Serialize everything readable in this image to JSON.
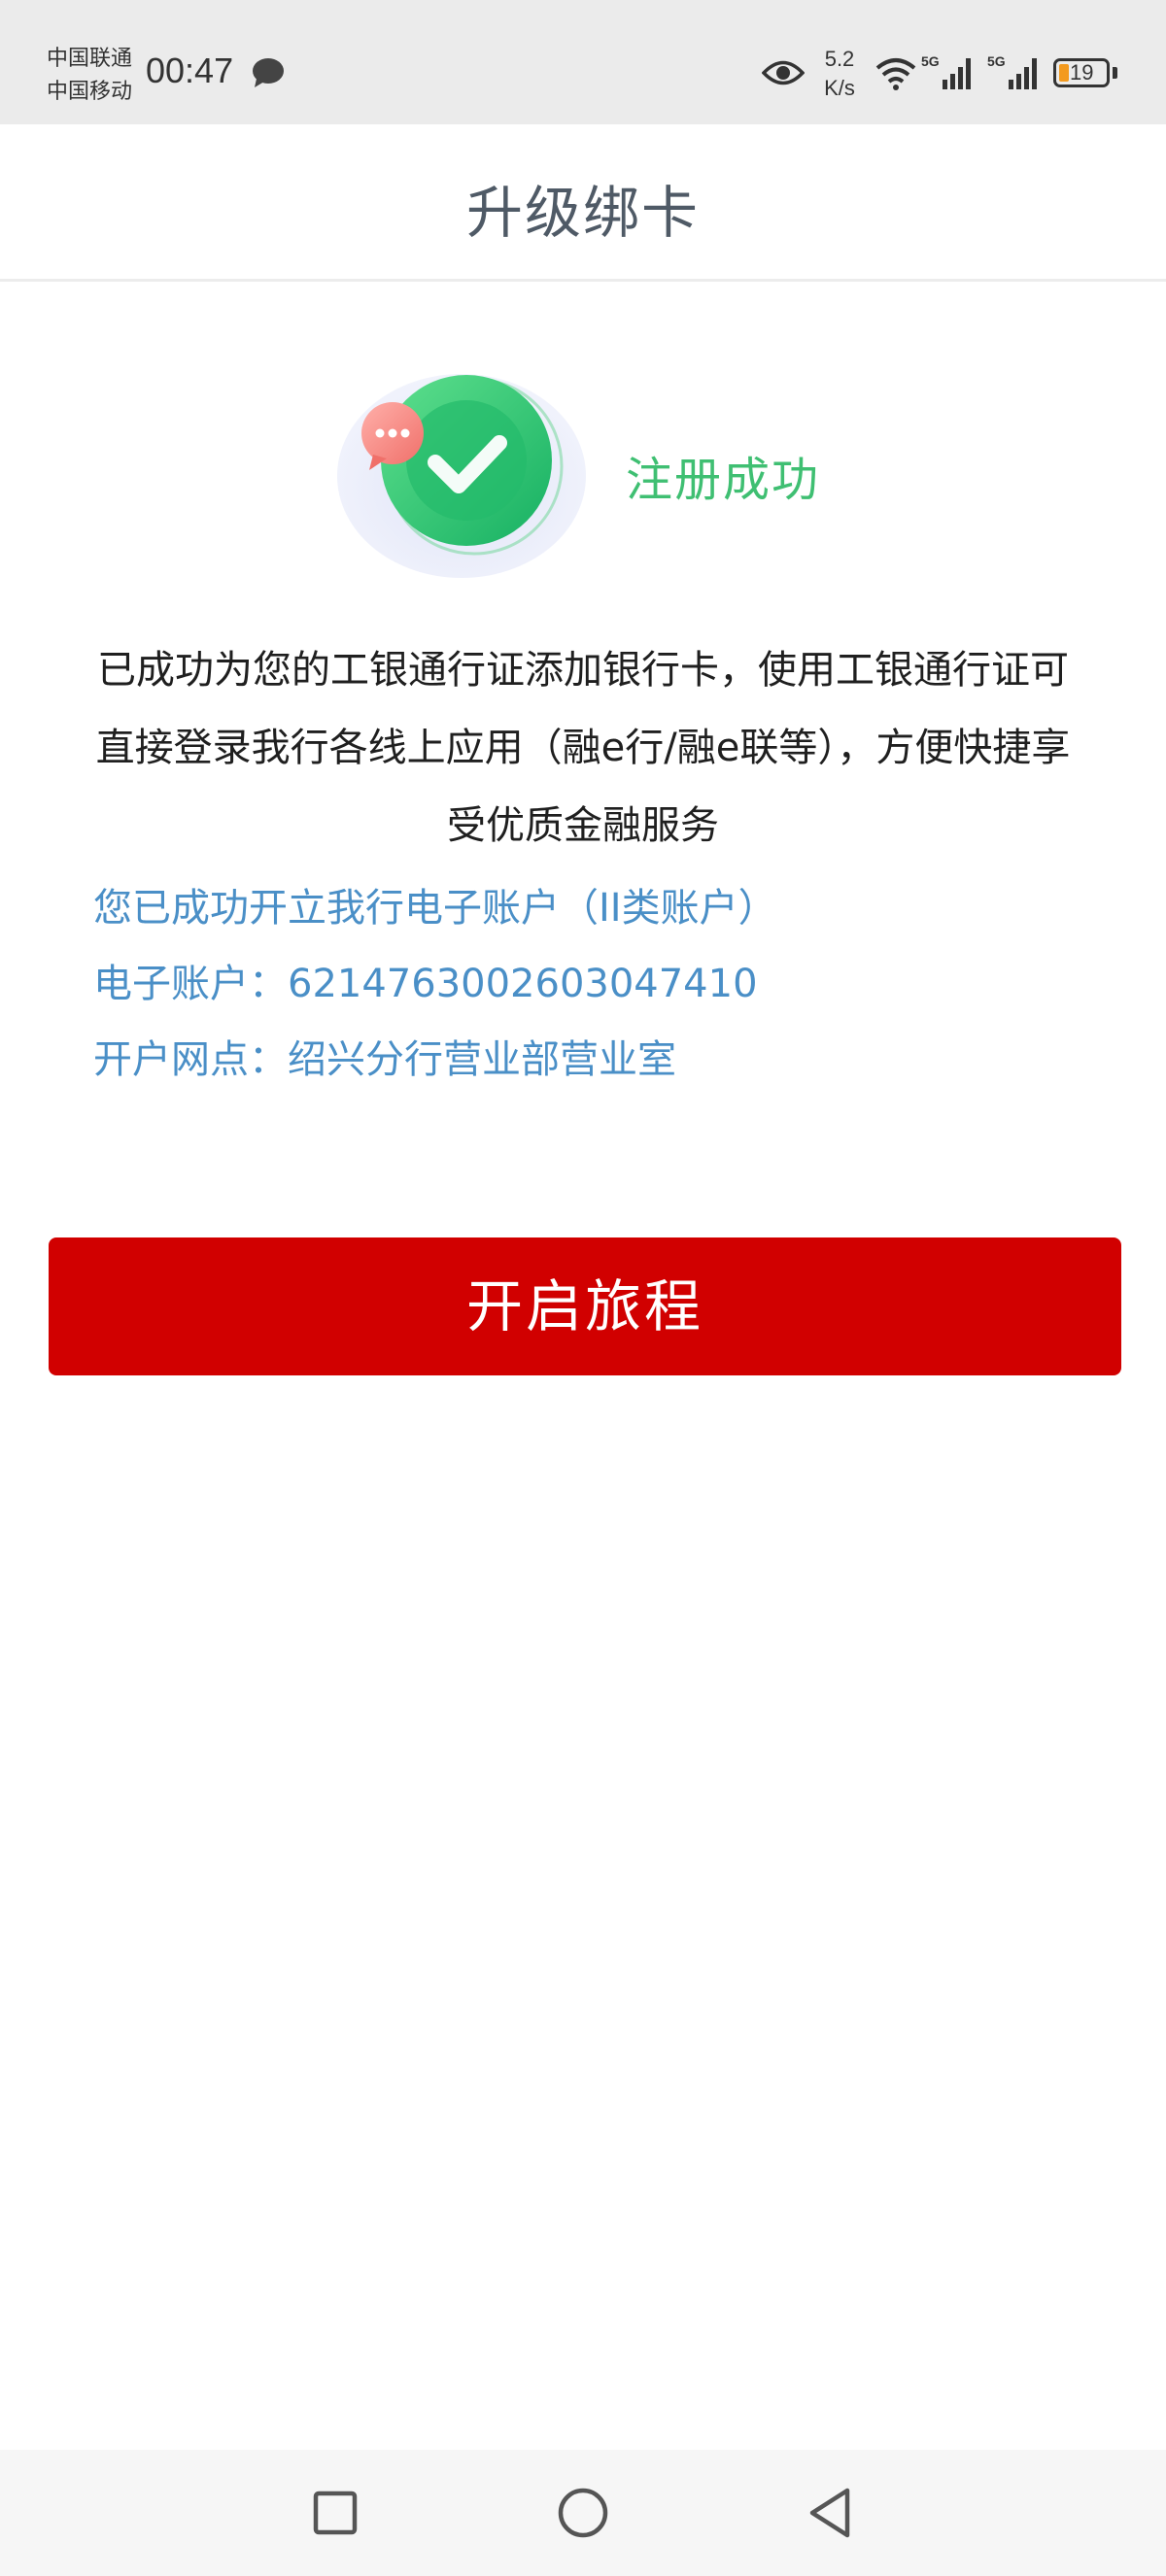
{
  "status_bar": {
    "carrier_1": "中国联通",
    "carrier_2": "中国移动",
    "time": "00:47",
    "net_speed_value": "5.2",
    "net_speed_unit": "K/s",
    "signal_1_label": "5G",
    "signal_2_label": "5G",
    "battery_level": "19",
    "battery_color": "#f39a1e"
  },
  "header": {
    "title": "升级绑卡"
  },
  "success": {
    "status_text": "注册成功",
    "accent_color": "#3fbf72",
    "icon": "check-circle-icon",
    "badge_icon": "chat-bubble-icon"
  },
  "main": {
    "description": "已成功为您的工银通行证添加银行卡，使用工银通行证可直接登录我行各线上应用（融e行/融e联等），方便快捷享受优质金融服务",
    "account_opened": "您已成功开立我行电子账户（II类账户）",
    "account_number": "电子账户：6214763002603047410",
    "branch": "开户网点：绍兴分行营业部营业室",
    "info_color": "#4a8fc7"
  },
  "actions": {
    "start_button_label": "开启旅程",
    "button_color": "#d10000"
  },
  "system_nav": {
    "recent_icon": "square-icon",
    "home_icon": "circle-icon",
    "back_icon": "triangle-back-icon"
  }
}
